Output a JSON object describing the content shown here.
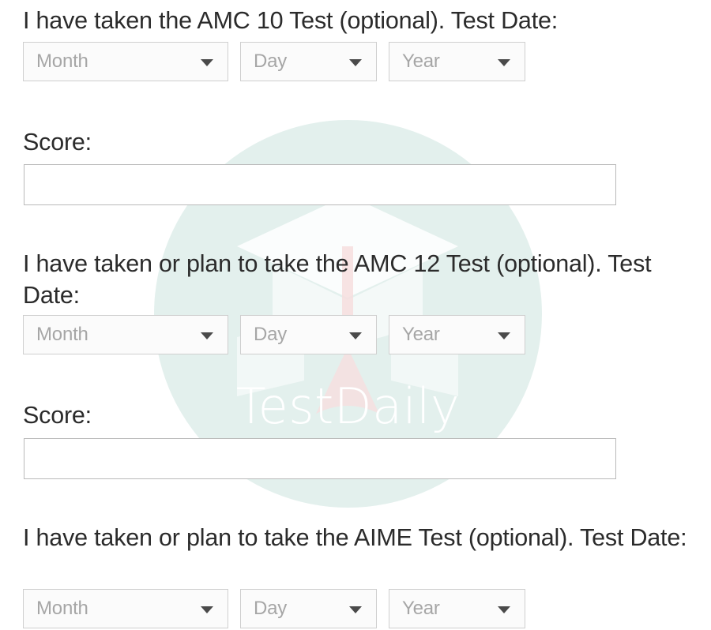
{
  "watermark": {
    "brand_text": "TestDaily",
    "circle_color": "#e3f0ed",
    "text_color": "#ffffff",
    "cap_color": "#ffffff",
    "tassel_color": "#f6dede",
    "logo_icon": "graduation-cap-icon"
  },
  "placeholders": {
    "month": "Month",
    "day": "Day",
    "year": "Year"
  },
  "icons": {
    "dropdown_caret": "chevron-down-icon"
  },
  "sections": [
    {
      "id": "amc10",
      "question": "I have taken the AMC 10 Test (optional). Test Date:",
      "score_label": "Score:",
      "score_value": "",
      "score_placeholder": ""
    },
    {
      "id": "amc12",
      "question": "I have taken or plan to take the AMC 12 Test (optional). Test Date:",
      "score_label": "Score:",
      "score_value": "",
      "score_placeholder": ""
    },
    {
      "id": "aime",
      "question": "I have taken or plan to take the AIME Test (optional). Test Date:",
      "score_label": "",
      "score_value": "",
      "score_placeholder": ""
    }
  ]
}
